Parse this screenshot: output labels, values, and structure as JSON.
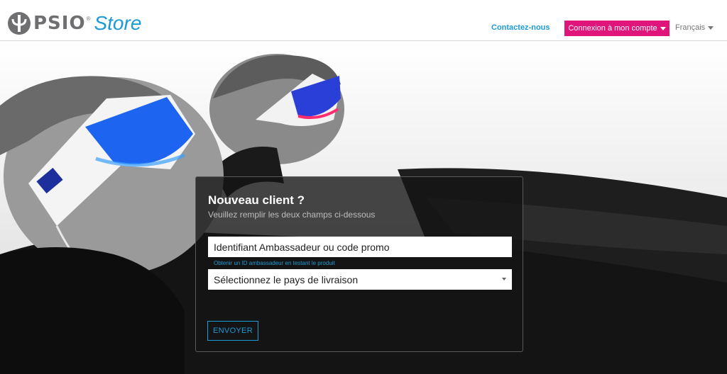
{
  "header": {
    "logo": {
      "brand": "PSIO",
      "registered": "®",
      "store": "Store"
    },
    "nav": {
      "contact_label": "Contactez-nous",
      "login_label": "Connexion à mon compte",
      "language_label": "Français"
    }
  },
  "hero": {
    "image": "two people reclining wearing light therapy glasses (blue and red)"
  },
  "form": {
    "title": "Nouveau client ?",
    "subtitle": "Veuillez remplir les deux champs ci-dessous",
    "ambassador_field": {
      "placeholder": "Identifiant Ambassadeur ou code promo",
      "value": ""
    },
    "help_link": "Obtenir un ID ambassadeur en testant le produit",
    "country_select": {
      "selected": "Sélectionnez le pays de livraison"
    },
    "submit_label": "ENVOYER"
  },
  "colors": {
    "accent_blue": "#1c9ad6",
    "accent_pink": "#e0157c",
    "logo_grey": "#6f6f72"
  }
}
